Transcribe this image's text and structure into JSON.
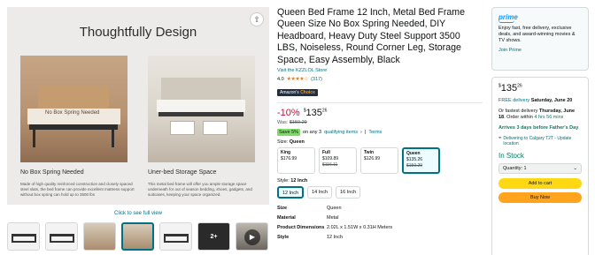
{
  "gallery": {
    "heading": "Thoughtfully Design",
    "feature_a": {
      "tag": "No Box Spring Needed",
      "caption": "No Box Spring Needed",
      "desc": "Made of high quality reinforced construction and closely spaced steel slats, the bed frame can provide excellent mattress support without box spring can hold up to 3500 lbs"
    },
    "feature_b": {
      "caption": "Uner-bed Storage Space",
      "desc": "This metal bed frame will offer you ample storage space underneath for out of season bedding, shoes, gadgets, and suitcases, keeping your space organized."
    },
    "full_view": "Click to see full view",
    "thumb_more": "2+"
  },
  "product": {
    "title": "Queen Bed Frame 12 Inch, Metal Bed Frame Queen Size No Box Spring Needed, DIY Headboard, Heavy Duty Steel Support 3500 LBS, Noiseless, Round Corner Leg, Storage Space, Easy Assembly, Black",
    "store": "Visit the KZZLOL Store",
    "rating": "4.0",
    "stars": "★★★★☆",
    "rating_count": "(317)",
    "choice_a": "Amazon's",
    "choice_b": "Choice",
    "discount": "-10%",
    "price_symbol": "$",
    "price_whole": "135",
    "price_fraction": "26",
    "was_label": "Was:",
    "was_price": "$150.29",
    "save_badge": "Save 5%",
    "save_text": "on any 3",
    "qualifying": "qualifying items",
    "terms": "Terms",
    "size_label": "Size:",
    "size_value": "Queen",
    "sizes": [
      {
        "name": "King",
        "price": "$176.99",
        "old": ""
      },
      {
        "name": "Full",
        "price": "$109.89",
        "old": "$116.11"
      },
      {
        "name": "Twin",
        "price": "$126.99",
        "old": ""
      },
      {
        "name": "Queen",
        "price": "$135.26",
        "old": "$150.29"
      }
    ],
    "style_label": "Style:",
    "style_value": "12 Inch",
    "styles": [
      "12 Inch",
      "14 Inch",
      "16 Inch"
    ],
    "specs": [
      {
        "k": "Size",
        "v": "Queen"
      },
      {
        "k": "Material",
        "v": "Metal"
      },
      {
        "k": "Product Dimensions",
        "v": "2.02L x 1.51W x 0.31H Meters"
      },
      {
        "k": "Style",
        "v": "12 Inch"
      }
    ]
  },
  "prime": {
    "logo": "prime",
    "text": "Enjoy fast, free delivery, exclusive deals, and award-winning movies & TV shows.",
    "join": "Join Prime"
  },
  "buybox": {
    "price_symbol": "$",
    "price_whole": "135",
    "price_fraction": "26",
    "free_delivery": "FREE delivery",
    "free_date": "Saturday, June 20",
    "fastest": "Or fastest delivery",
    "fastest_date": "Thursday, June 18",
    "order_within": ". Order within",
    "countdown": "4 hrs 56 mins",
    "arrives": "Arrives 3 days before Father's Day",
    "deliver_to": "Delivering to Calgary T2T - Update location",
    "stock": "In Stock",
    "quantity": "Quantity: 1",
    "add_to_cart": "Add to cart",
    "buy_now": "Buy Now"
  }
}
